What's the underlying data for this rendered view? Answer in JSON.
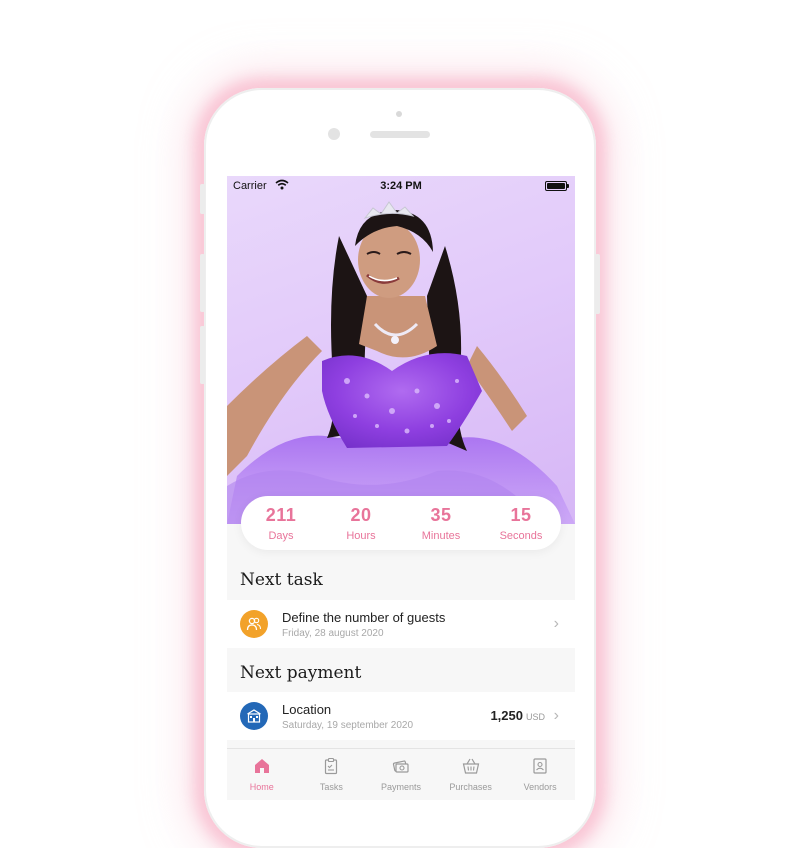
{
  "status_bar": {
    "carrier": "Carrier",
    "time": "3:24 PM"
  },
  "countdown": [
    {
      "value": "211",
      "label": "Days"
    },
    {
      "value": "20",
      "label": "Hours"
    },
    {
      "value": "35",
      "label": "Minutes"
    },
    {
      "value": "15",
      "label": "Seconds"
    }
  ],
  "next_task": {
    "heading": "Next task",
    "title": "Define the number of guests",
    "date": "Friday, 28 august 2020",
    "icon": "guests-icon",
    "icon_color": "#f2a22a"
  },
  "next_payment": {
    "heading": "Next payment",
    "title": "Location",
    "date": "Saturday, 19 september 2020",
    "amount": "1,250",
    "currency": "USD",
    "icon": "venue-icon",
    "icon_color": "#2368b7"
  },
  "tabs": [
    {
      "label": "Home",
      "icon": "home-icon",
      "active": true
    },
    {
      "label": "Tasks",
      "icon": "clipboard-icon",
      "active": false
    },
    {
      "label": "Payments",
      "icon": "money-icon",
      "active": false
    },
    {
      "label": "Purchases",
      "icon": "basket-icon",
      "active": false
    },
    {
      "label": "Vendors",
      "icon": "vendor-card-icon",
      "active": false
    }
  ],
  "colors": {
    "accent": "#e8749a",
    "hero_bg": "#e2cafa",
    "glow": "#f8bacc"
  }
}
